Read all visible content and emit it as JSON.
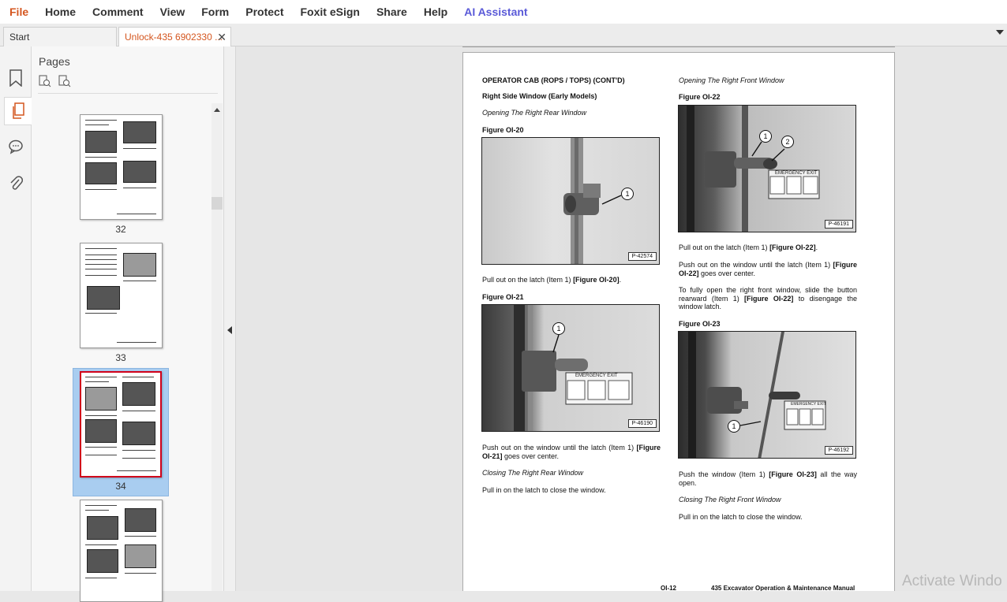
{
  "menu": {
    "items": [
      {
        "label": "File"
      },
      {
        "label": "Home"
      },
      {
        "label": "Comment"
      },
      {
        "label": "View"
      },
      {
        "label": "Form"
      },
      {
        "label": "Protect"
      },
      {
        "label": "Foxit eSign"
      },
      {
        "label": "Share"
      },
      {
        "label": "Help"
      },
      {
        "label": "AI Assistant"
      }
    ]
  },
  "tabs": {
    "start": "Start",
    "doc": "Unlock-435 6902330 ...",
    "close": "✕"
  },
  "panel": {
    "title": "Pages",
    "thumbs": [
      {
        "num": "32"
      },
      {
        "num": "33"
      },
      {
        "num": "34"
      }
    ]
  },
  "page": {
    "left": {
      "heading": "OPERATOR CAB (ROPS / TOPS) (CONT'D)",
      "subheading": "Right Side Window (Early Models)",
      "sub_italic": "Opening The Right Rear Window",
      "fig20_label": "Figure OI-20",
      "fig20_code": "P-42574",
      "text1_a": "Pull out on the latch (Item 1) ",
      "text1_b": "[Figure OI-20]",
      "text1_c": ".",
      "fig21_label": "Figure OI-21",
      "fig21_code": "P-46190",
      "text2": "Push out on the window until the latch (Item 1) ",
      "text2_b": "[Figure OI-21]",
      "text2_c": " goes over center.",
      "closing_italic": "Closing The Right Rear Window",
      "text3": "Pull in on the latch to close the window."
    },
    "right": {
      "sub_italic": "Opening The Right Front Window",
      "fig22_label": "Figure OI-22",
      "fig22_code": "P-46191",
      "text1_a": "Pull out on the latch (Item 1) ",
      "text1_b": "[Figure OI-22]",
      "text1_c": ".",
      "text2_a": "Push out on the window until the latch (Item 1) ",
      "text2_b": "[Figure OI-22]",
      "text2_c": " goes over center.",
      "text3_a": "To fully open the right front window, slide the button rearward (Item 1) ",
      "text3_b": "[Figure OI-22]",
      "text3_c": " to disengage the window latch.",
      "fig23_label": "Figure OI-23",
      "fig23_code": "P-46192",
      "text4_a": "Push the window (Item 1) ",
      "text4_b": "[Figure OI-23]",
      "text4_c": " all the way open.",
      "closing_italic": "Closing The Right Front Window",
      "text5": "Pull in on the latch to close the window."
    },
    "callouts": {
      "one": "1",
      "two": "2"
    },
    "emergency_label": "EMERGENCY EXIT",
    "footer_page": "OI-12",
    "footer_title": "435 Excavator Operation & Maintenance Manual"
  },
  "watermark": "Activate Windo",
  "colors": {
    "accent": "#d4561f",
    "ai": "#5a5ad8",
    "selection": "#a9cdf0",
    "thumb_border_selected": "#d0021b"
  }
}
